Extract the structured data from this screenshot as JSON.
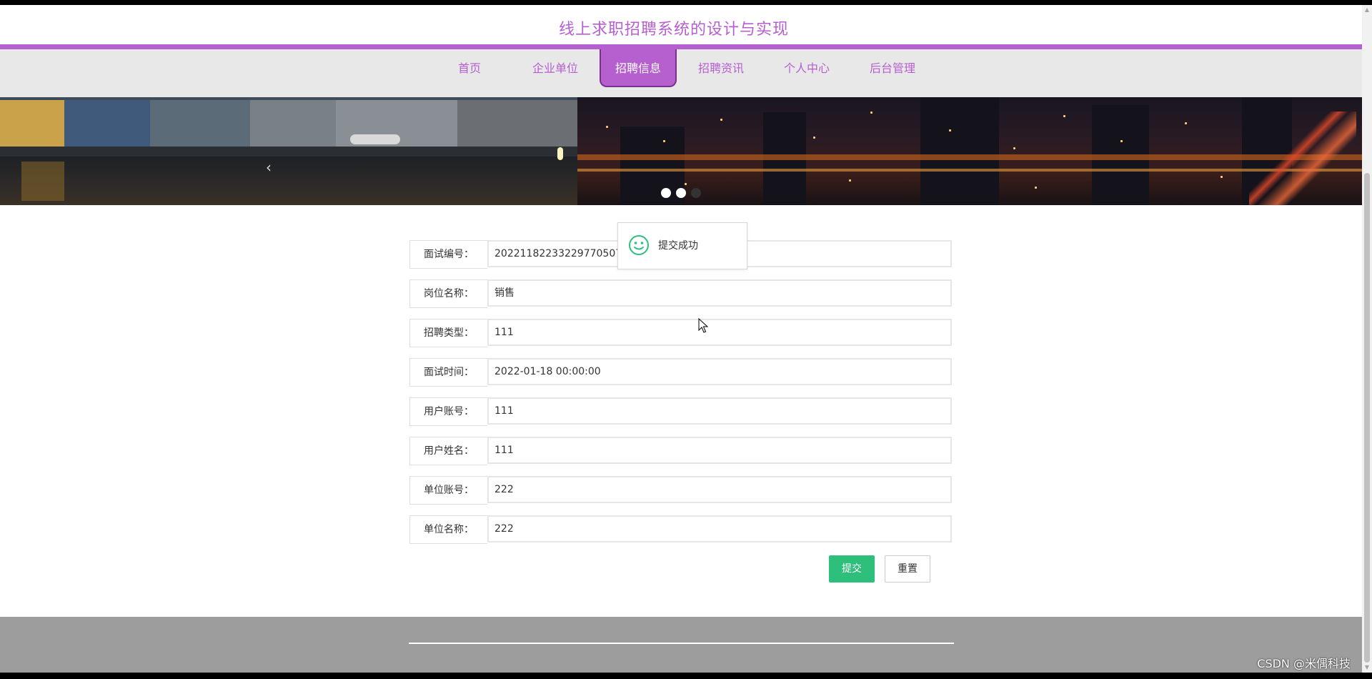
{
  "header": {
    "title": "线上求职招聘系统的设计与实现"
  },
  "nav": {
    "items": [
      {
        "label": "首页"
      },
      {
        "label": "企业单位"
      },
      {
        "label": "招聘信息",
        "active": true
      },
      {
        "label": "招聘资讯"
      },
      {
        "label": "个人中心"
      },
      {
        "label": "后台管理"
      }
    ]
  },
  "banner": {
    "dots": 3,
    "active_dot": 1
  },
  "form": {
    "fields": [
      {
        "label": "面试编号：",
        "value": "20221182233229770507"
      },
      {
        "label": "岗位名称：",
        "value": "销售"
      },
      {
        "label": "招聘类型：",
        "value": "111"
      },
      {
        "label": "面试时间：",
        "value": "2022-01-18 00:00:00"
      },
      {
        "label": "用户账号：",
        "value": "111"
      },
      {
        "label": "用户姓名：",
        "value": "111"
      },
      {
        "label": "单位账号：",
        "value": "222"
      },
      {
        "label": "单位名称：",
        "value": "222"
      }
    ],
    "submit_label": "提交",
    "reset_label": "重置"
  },
  "toast": {
    "text": "提交成功",
    "icon": "smile-icon",
    "color": "#2fbf7c"
  },
  "watermark": "CSDN @米偶科技",
  "colors": {
    "accent": "#b65fcf",
    "success": "#2fbf7c",
    "footer": "#9d9d9d"
  }
}
